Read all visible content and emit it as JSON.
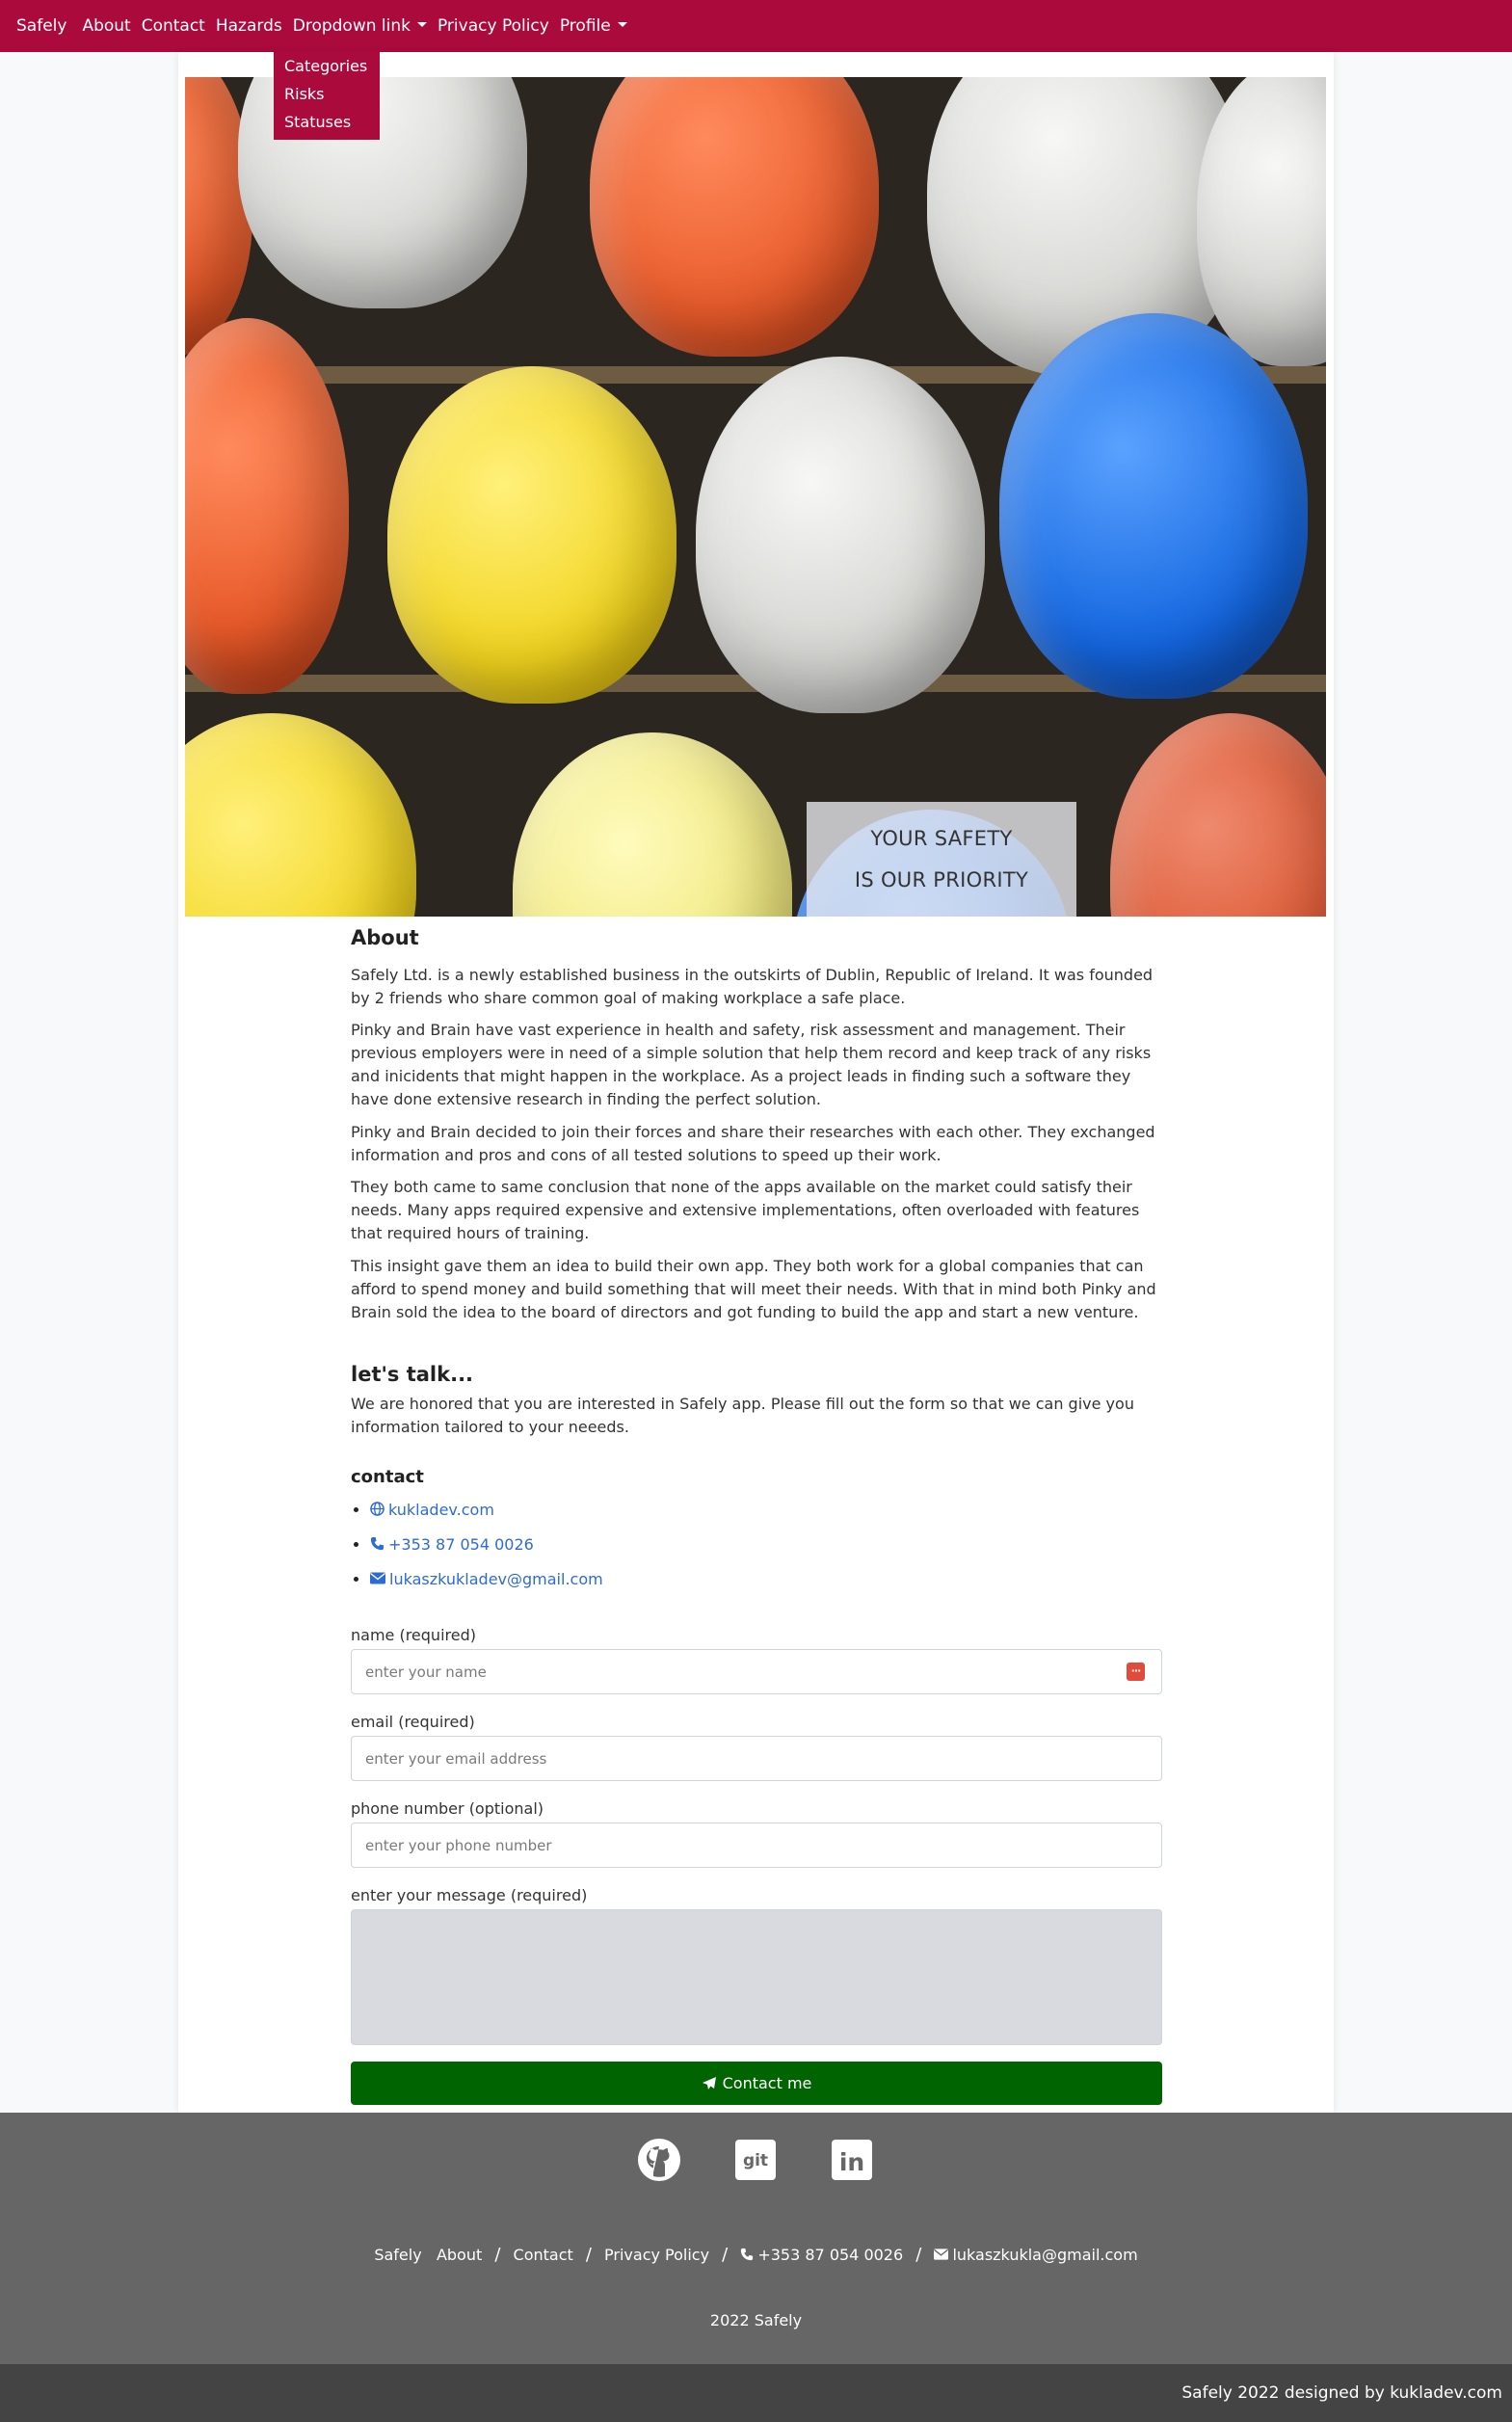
{
  "nav": {
    "brand": "Safely",
    "items": [
      "About",
      "Contact",
      "Hazards"
    ],
    "dropdown_label": "Dropdown link",
    "privacy": "Privacy Policy",
    "profile": "Profile",
    "dropdown_items": [
      "Categories",
      "Risks",
      "Statuses"
    ]
  },
  "hero": {
    "line1": "YOUR SAFETY",
    "line2": "IS OUR PRIORITY"
  },
  "about": {
    "title": "About",
    "paragraphs": [
      "Safely Ltd. is a newly established business in the outskirts of Dublin, Republic of Ireland. It was founded by 2 friends who share common goal of making workplace a safe place.",
      "Pinky and Brain have vast experience in health and safety, risk assessment and management. Their previous employers were in need of a simple solution that help them record and keep track of any risks and inicidents that might happen in the workplace. As a project leads in finding such a software they have done extensive research in finding the perfect solution.",
      "Pinky and Brain decided to join their forces and share their researches with each other. They exchanged information and pros and cons of all tested solutions to speed up their work.",
      "They both came to same conclusion that none of the apps available on the market could satisfy their needs. Many apps required expensive and extensive implementations, often overloaded with features that required hours of training.",
      "This insight gave them an idea to build their own app. They both work for a global companies that can afford to spend money and build something that will meet their needs. With that in mind both Pinky and Brain sold the idea to the board of directors and got funding to build the app and start a new venture."
    ]
  },
  "talk": {
    "title": "let's talk...",
    "text": "We are honored that you are interested in Safely app. Please fill out the form so that we can give you information tailored to your neeeds."
  },
  "contact": {
    "title": "contact",
    "website": "kukladev.com",
    "phone": "+353 87 054 0026",
    "email": "lukaszkukladev@gmail.com"
  },
  "form": {
    "name_label": "name (required)",
    "name_placeholder": "enter your name",
    "email_label": "email (required)",
    "email_placeholder": "enter your email address",
    "phone_label": "phone number (optional)",
    "phone_placeholder": "enter your phone number",
    "message_label": "enter your message (required)",
    "submit": "Contact me",
    "pw_icon_text": "···"
  },
  "footer": {
    "github_icon": "github-icon",
    "git_icon": "git-icon",
    "git_text": "git",
    "linkedin_icon": "linkedin-icon",
    "linkedin_text": "in",
    "brand": "Safely",
    "about": "About",
    "contact": "Contact",
    "privacy": "Privacy Policy",
    "phone": "+353 87 054 0026",
    "email": "lukaszkukla@gmail.com",
    "separator": "/",
    "copyright": "2022 Safely",
    "credit": "Safely 2022 designed by kukladev.com"
  },
  "colors": {
    "nav_bg": "#ab0a3d",
    "button_bg": "#006400",
    "footer_bg": "#666666",
    "bottom_bar_bg": "#444444",
    "link": "#2e6bd6"
  }
}
